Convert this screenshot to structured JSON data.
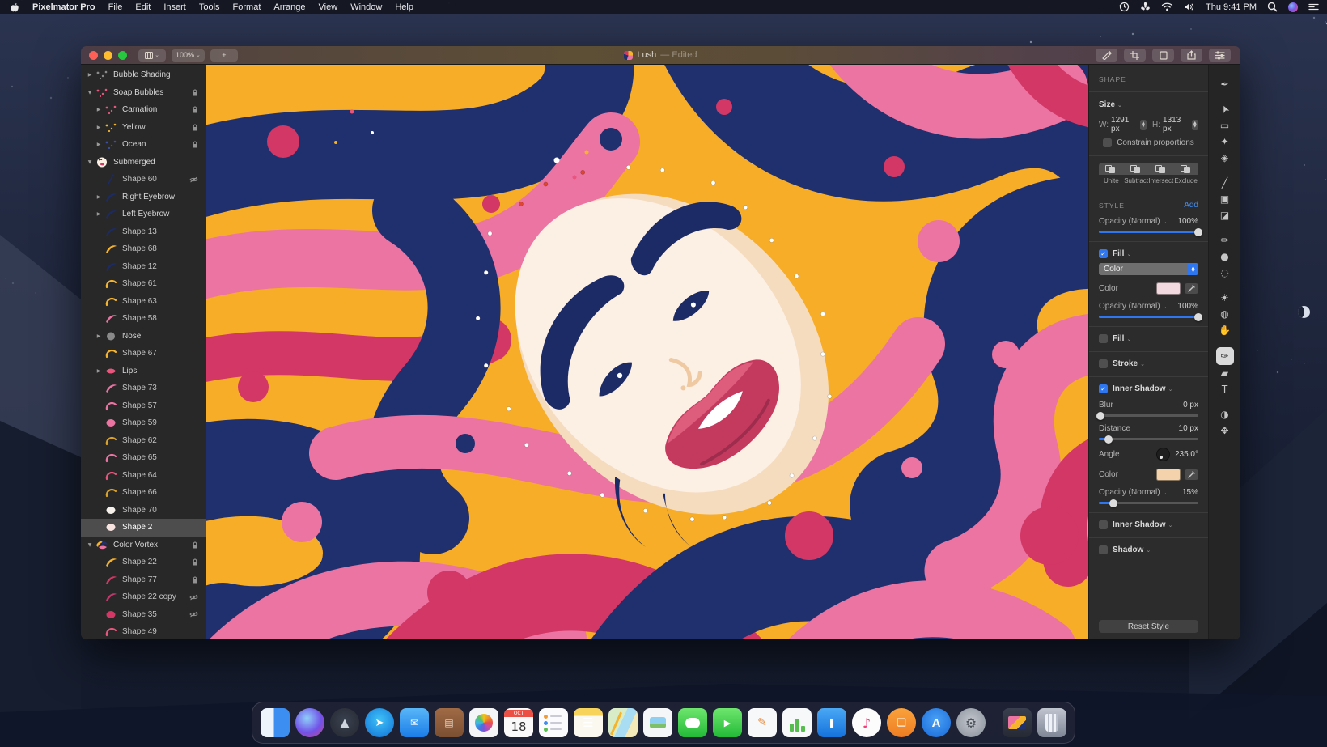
{
  "menu_bar": {
    "apple_icon": "apple-logo",
    "app_name": "Pixelmator Pro",
    "menus": [
      "File",
      "Edit",
      "Insert",
      "Tools",
      "Format",
      "Arrange",
      "View",
      "Window",
      "Help"
    ],
    "status_icons": [
      "time-machine",
      "fan",
      "wifi",
      "volume"
    ],
    "clock": "Thu 9:41 PM",
    "right_icons": [
      "spotlight",
      "siri",
      "notification-center"
    ]
  },
  "window": {
    "title": "Lush",
    "title_suffix": "— Edited",
    "zoom_level": "100%",
    "add_tab_label": "+",
    "toolbar_right": [
      "annotate",
      "crop",
      "canvas-size",
      "share",
      "view-options"
    ],
    "tools": [
      {
        "name": "quill"
      },
      {
        "name": "pointer",
        "gap": true
      },
      {
        "name": "rect-select"
      },
      {
        "name": "quick-select"
      },
      {
        "name": "magnetic-select"
      },
      {
        "name": "line",
        "gap": true
      },
      {
        "name": "clone"
      },
      {
        "name": "eraser"
      },
      {
        "name": "pencil",
        "gap": true
      },
      {
        "name": "paint"
      },
      {
        "name": "blur"
      },
      {
        "name": "adjust",
        "gap": true
      },
      {
        "name": "effects"
      },
      {
        "name": "warp"
      },
      {
        "name": "vector-pen",
        "selected": true,
        "gap": true
      },
      {
        "name": "shape"
      },
      {
        "name": "text"
      },
      {
        "name": "color-fill",
        "gap": true
      },
      {
        "name": "arrange"
      }
    ]
  },
  "layers": [
    {
      "name": "Bubble Shading",
      "depth": 0,
      "group": true,
      "disc": "closed",
      "thumb": {
        "type": "dots",
        "color": "#8a8a8a"
      }
    },
    {
      "name": "Soap Bubbles",
      "depth": 0,
      "group": true,
      "disc": "open",
      "lock": true,
      "thumb": {
        "type": "dots",
        "color": "#e8557d"
      }
    },
    {
      "name": "Carnation",
      "depth": 1,
      "group": true,
      "disc": "closed",
      "lock": true,
      "thumb": {
        "type": "dots",
        "color": "#e8557d"
      }
    },
    {
      "name": "Yellow",
      "depth": 1,
      "group": true,
      "disc": "closed",
      "lock": true,
      "thumb": {
        "type": "dots",
        "color": "#f6b42c"
      }
    },
    {
      "name": "Ocean",
      "depth": 1,
      "group": true,
      "disc": "closed",
      "lock": true,
      "thumb": {
        "type": "dots",
        "color": "#3a4fa5"
      }
    },
    {
      "name": "Submerged",
      "depth": 0,
      "group": true,
      "disc": "open",
      "thumb": {
        "type": "face",
        "color": "#fcefe4"
      }
    },
    {
      "name": "Shape 60",
      "depth": 1,
      "hidden": true,
      "thumb": {
        "type": "line",
        "color": "#1c2b66"
      }
    },
    {
      "name": "Right Eyebrow",
      "depth": 1,
      "group": true,
      "disc": "closed",
      "thumb": {
        "type": "swoosh",
        "color": "#1c2b66"
      }
    },
    {
      "name": "Left Eyebrow",
      "depth": 1,
      "group": true,
      "disc": "closed",
      "thumb": {
        "type": "swoosh",
        "color": "#1c2b66"
      }
    },
    {
      "name": "Shape 13",
      "depth": 1,
      "thumb": {
        "type": "swoosh",
        "color": "#1c2b66"
      }
    },
    {
      "name": "Shape 68",
      "depth": 1,
      "thumb": {
        "type": "swoosh",
        "color": "#f6b42c"
      }
    },
    {
      "name": "Shape 12",
      "depth": 1,
      "thumb": {
        "type": "swoosh",
        "color": "#1c2b66"
      }
    },
    {
      "name": "Shape 61",
      "depth": 1,
      "thumb": {
        "type": "arc",
        "color": "#f6b42c"
      }
    },
    {
      "name": "Shape 63",
      "depth": 1,
      "thumb": {
        "type": "arc",
        "color": "#f6b42c"
      }
    },
    {
      "name": "Shape 58",
      "depth": 1,
      "thumb": {
        "type": "swoosh",
        "color": "#ec74a2"
      }
    },
    {
      "name": "Nose",
      "depth": 1,
      "group": true,
      "disc": "closed",
      "thumb": {
        "type": "circle",
        "color": "#8a8a8a"
      }
    },
    {
      "name": "Shape 67",
      "depth": 1,
      "thumb": {
        "type": "arc",
        "color": "#f6b42c"
      }
    },
    {
      "name": "Lips",
      "depth": 1,
      "group": true,
      "disc": "closed",
      "thumb": {
        "type": "lips",
        "color": "#e8557d"
      }
    },
    {
      "name": "Shape 73",
      "depth": 1,
      "thumb": {
        "type": "swoosh",
        "color": "#ec74a2"
      }
    },
    {
      "name": "Shape 57",
      "depth": 1,
      "thumb": {
        "type": "arc",
        "color": "#ec74a2"
      }
    },
    {
      "name": "Shape 59",
      "depth": 1,
      "thumb": {
        "type": "blob",
        "color": "#ec74a2"
      }
    },
    {
      "name": "Shape 62",
      "depth": 1,
      "thumb": {
        "type": "arc",
        "color": "#d9a32a"
      }
    },
    {
      "name": "Shape 65",
      "depth": 1,
      "thumb": {
        "type": "arc",
        "color": "#ec74a2"
      }
    },
    {
      "name": "Shape 64",
      "depth": 1,
      "thumb": {
        "type": "arc",
        "color": "#e8557d"
      }
    },
    {
      "name": "Shape 66",
      "depth": 1,
      "thumb": {
        "type": "arc",
        "color": "#d9a32a"
      }
    },
    {
      "name": "Shape 70",
      "depth": 1,
      "thumb": {
        "type": "blob",
        "color": "#f5f0ea"
      }
    },
    {
      "name": "Shape 2",
      "depth": 1,
      "selected": true,
      "thumb": {
        "type": "blob",
        "color": "#f7e3e0"
      }
    },
    {
      "name": "Color Vortex",
      "depth": 0,
      "group": true,
      "disc": "open",
      "lock": true,
      "thumb": {
        "type": "multi",
        "color": "#ec74a2"
      }
    },
    {
      "name": "Shape 22",
      "depth": 1,
      "lock": true,
      "thumb": {
        "type": "swoosh",
        "color": "#f6b42c"
      }
    },
    {
      "name": "Shape 77",
      "depth": 1,
      "lock": true,
      "thumb": {
        "type": "swoosh",
        "color": "#d23765"
      }
    },
    {
      "name": "Shape 22 copy",
      "depth": 1,
      "hidden": true,
      "thumb": {
        "type": "swoosh",
        "color": "#c2386a"
      }
    },
    {
      "name": "Shape 35",
      "depth": 1,
      "hidden": true,
      "thumb": {
        "type": "blob",
        "color": "#d23765"
      }
    },
    {
      "name": "Shape 49",
      "depth": 1,
      "thumb": {
        "type": "arc",
        "color": "#e8557d"
      }
    }
  ],
  "inspector": {
    "panel_title": "SHAPE",
    "accent": "#2E77F0",
    "size": {
      "label": "Size",
      "w_label": "W:",
      "w_value": "1291 px",
      "h_label": "H:",
      "h_value": "1313 px",
      "constrain_label": "Constrain proportions",
      "constrain_checked": false
    },
    "boolean_ops": [
      "Unite",
      "Subtract",
      "Intersect",
      "Exclude"
    ],
    "style": {
      "header": "STYLE",
      "add_label": "Add",
      "opacity_label": "Opacity (Normal)",
      "opacity_value": "100%",
      "opacity_pct": 100
    },
    "fill": {
      "label": "Fill",
      "checked": true,
      "blend_dropdown": "Color",
      "color_label": "Color",
      "color_swatch": "#F2D9DF",
      "opacity_label": "Opacity (Normal)",
      "opacity_value": "100%",
      "opacity_pct": 100
    },
    "fill2": {
      "label": "Fill",
      "checked": false
    },
    "stroke": {
      "label": "Stroke",
      "checked": false
    },
    "inner_shadow": {
      "label": "Inner Shadow",
      "checked": true,
      "blur_label": "Blur",
      "blur_value": "0 px",
      "blur_pct": 2,
      "distance_label": "Distance",
      "distance_value": "10 px",
      "distance_pct": 10,
      "angle_label": "Angle",
      "angle_value": "235.0°",
      "color_label": "Color",
      "color_swatch": "#F4D2AB",
      "opacity_label": "Opacity (Normal)",
      "opacity_value": "15%",
      "opacity_pct": 15
    },
    "inner_shadow2": {
      "label": "Inner Shadow",
      "checked": false
    },
    "shadow": {
      "label": "Shadow",
      "checked": false
    },
    "reset_label": "Reset Style"
  },
  "dock": {
    "items": [
      {
        "name": "finder",
        "shape": "square"
      },
      {
        "name": "siri",
        "shape": "circle"
      },
      {
        "name": "launchpad",
        "shape": "circle"
      },
      {
        "name": "safari",
        "shape": "circle"
      },
      {
        "name": "mail",
        "shape": "square"
      },
      {
        "name": "contacts",
        "shape": "square"
      },
      {
        "name": "photos",
        "shape": "square"
      },
      {
        "name": "calendar",
        "shape": "square"
      },
      {
        "name": "reminders",
        "shape": "square"
      },
      {
        "name": "notes",
        "shape": "square"
      },
      {
        "name": "maps",
        "shape": "square"
      },
      {
        "name": "preview",
        "shape": "square"
      },
      {
        "name": "messages",
        "shape": "square"
      },
      {
        "name": "facetime",
        "shape": "square"
      },
      {
        "name": "pages",
        "shape": "square"
      },
      {
        "name": "numbers",
        "shape": "square"
      },
      {
        "name": "keynote",
        "shape": "square"
      },
      {
        "name": "music",
        "shape": "circle"
      },
      {
        "name": "books",
        "shape": "circle"
      },
      {
        "name": "app-store",
        "shape": "circle"
      },
      {
        "name": "system-preferences",
        "shape": "circle"
      },
      {
        "name": "divider"
      },
      {
        "name": "stack",
        "shape": "square"
      },
      {
        "name": "trash",
        "shape": "square"
      }
    ],
    "calendar": {
      "month": "OCT",
      "day": "18"
    }
  }
}
